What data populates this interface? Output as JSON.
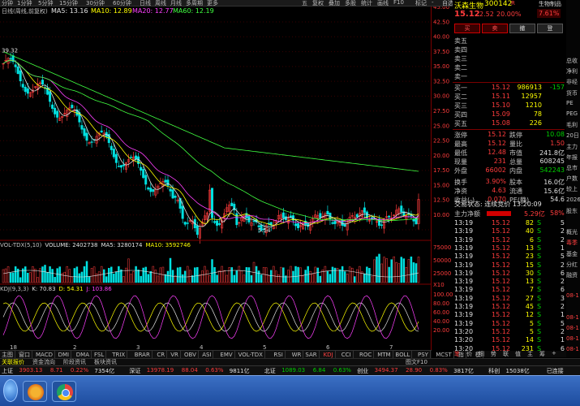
{
  "toolbar": {
    "cycles": [
      "分钟",
      "1分钟",
      "5分钟",
      "15分钟",
      "30分钟",
      "60分钟",
      "日线",
      "周线",
      "月线",
      "多周期",
      "更多"
    ],
    "right_buttons": [
      "五",
      "复权",
      "叠加",
      "多股",
      "统计",
      "画线",
      "F10",
      "标记",
      "-",
      "自选",
      "返回"
    ]
  },
  "info": {
    "prefix": "日线(周线,前复权)",
    "ma5": "MA5: 13.16",
    "ma10": "MA10: 12.89",
    "ma20": "MA20: 12.77",
    "ma60": "MA60: 12.19",
    "high_mark": "39.32",
    "low_mark": "5.54"
  },
  "price_axis": [
    "45.00",
    "42.50",
    "40.00",
    "37.50",
    "35.00",
    "32.50",
    "30.00",
    "27.50",
    "25.00",
    "22.50",
    "20.00",
    "17.50",
    "15.00",
    "12.50",
    "10.00"
  ],
  "volume": {
    "title": "VOL-TDX(5,10)",
    "vol": "VOLUME: 2402738",
    "ma5": "MA5: 3280174",
    "ma10": "MA10: 3592746",
    "axis": [
      "75000",
      "50000",
      "25000",
      "X10"
    ]
  },
  "kdj": {
    "title": "KDJ(9,3,3)",
    "k": "K: 70.83",
    "d": "D: 54.31",
    "j": "J: 103.86",
    "axis": [
      "100.00",
      "80.00",
      "60.00",
      "40.00",
      "20.00"
    ]
  },
  "timeline_labels": [
    "18",
    "2",
    "3",
    "4",
    "5",
    "6",
    "7"
  ],
  "tabs": [
    "主图",
    "窗口",
    "MACD",
    "DMI",
    "DMA",
    "FSL",
    "TRIX",
    "BRAR",
    "CR",
    "VR",
    "OBV",
    "ASI",
    "EMV",
    "VOL-TDX",
    "RSI",
    "WR",
    "SAR",
    "KDJ",
    "CCI",
    "ROC",
    "MTM",
    "BOLL",
    "PSY",
    "MCST",
    "指标",
    "模板"
  ],
  "selected_tab": "KDJ",
  "tabs2": [
    "关联报价",
    "资金流向",
    "阶段资讯",
    "板块资讯"
  ],
  "tabs2_right": "图文F10",
  "stock": {
    "name": "沃森生物",
    "code": "300142",
    "badge": "R",
    "price": "15.12",
    "change": "2.52",
    "pct": "20.00%",
    "side_label": "生物制品",
    "side_pct": "7.61%"
  },
  "trade_buttons": [
    "买",
    "卖",
    "撤",
    "登"
  ],
  "asks": [
    {
      "label": "卖五",
      "price": "",
      "vol": ""
    },
    {
      "label": "卖四",
      "price": "",
      "vol": ""
    },
    {
      "label": "卖三",
      "price": "",
      "vol": ""
    },
    {
      "label": "卖二",
      "price": "",
      "vol": ""
    },
    {
      "label": "卖一",
      "price": "",
      "vol": ""
    }
  ],
  "bids": [
    {
      "label": "买一",
      "price": "15.12",
      "vol": "986913",
      "chg": "-157"
    },
    {
      "label": "买二",
      "price": "15.11",
      "vol": "12957",
      "chg": ""
    },
    {
      "label": "买三",
      "price": "15.10",
      "vol": "1210",
      "chg": ""
    },
    {
      "label": "买四",
      "price": "15.09",
      "vol": "78",
      "chg": ""
    },
    {
      "label": "买五",
      "price": "15.08",
      "vol": "226",
      "chg": ""
    }
  ],
  "stats": [
    {
      "l1": "涨停",
      "v1": "15.12",
      "l2": "跌停",
      "v2": "10.08"
    },
    {
      "l1": "最高",
      "v1": "15.12",
      "l2": "量比",
      "v2": "1.50"
    },
    {
      "l1": "最低",
      "v1": "12.48",
      "l2": "市值",
      "v2": "241.8亿"
    },
    {
      "l1": "现量",
      "v1": "231",
      "l2": "总量",
      "v2": "608245"
    },
    {
      "l1": "外盘",
      "v1": "66002",
      "l2": "内盘",
      "v2": "542243"
    },
    {
      "l1": "换手",
      "v1": "3.90%",
      "l2": "股本",
      "v2": "16.0亿"
    },
    {
      "l1": "净资",
      "v1": "4.63",
      "l2": "流通",
      "v2": "15.6亿"
    },
    {
      "l1": "收益(-)",
      "v1": "0.070",
      "l2": "PE(静)",
      "v2": "54.6"
    }
  ],
  "trade_status": "交易状态: 连续竞价 13:20:09",
  "main_inflow": {
    "label": "主力净额",
    "value": "5.29亿",
    "pct": "58%"
  },
  "ticks": [
    {
      "t": "13:19",
      "p": "15.12",
      "v": "82",
      "d": "S",
      "n": "5"
    },
    {
      "t": "13:19",
      "p": "15.12",
      "v": "40",
      "d": "S",
      "n": "2"
    },
    {
      "t": "13:19",
      "p": "15.12",
      "v": "6",
      "d": "S",
      "n": "2"
    },
    {
      "t": "13:19",
      "p": "15.12",
      "v": "13",
      "d": "S",
      "n": "1"
    },
    {
      "t": "13:19",
      "p": "15.12",
      "v": "23",
      "d": "S",
      "n": "5"
    },
    {
      "t": "13:19",
      "p": "15.12",
      "v": "15",
      "d": "S",
      "n": "2"
    },
    {
      "t": "13:19",
      "p": "15.12",
      "v": "30",
      "d": "S",
      "n": "6"
    },
    {
      "t": "13:19",
      "p": "15.12",
      "v": "13",
      "d": "S",
      "n": "2"
    },
    {
      "t": "13:19",
      "p": "15.12",
      "v": "7",
      "d": "S",
      "n": "6"
    },
    {
      "t": "13:19",
      "p": "15.12",
      "v": "27",
      "d": "S",
      "n": "3"
    },
    {
      "t": "13:19",
      "p": "15.12",
      "v": "45",
      "d": "S",
      "n": "2"
    },
    {
      "t": "13:19",
      "p": "15.12",
      "v": "12",
      "d": "S",
      "n": "1"
    },
    {
      "t": "13:19",
      "p": "15.12",
      "v": "5",
      "d": "S",
      "n": "5"
    },
    {
      "t": "13:20",
      "p": "15.12",
      "v": "5",
      "d": "S",
      "n": "2"
    },
    {
      "t": "13:20",
      "p": "15.12",
      "v": "14",
      "d": "S",
      "n": "1"
    },
    {
      "t": "13:20",
      "p": "15.12",
      "v": "231",
      "d": "S",
      "n": "6"
    }
  ],
  "bottom_tabs": [
    "笔",
    "价",
    "细",
    "势",
    "联",
    "值",
    "主",
    "筹",
    "+"
  ],
  "narrow": [
    "总收",
    "净利",
    "非经",
    "货币",
    "PE",
    "PEG",
    "毛利",
    "20日",
    "主力",
    "年报",
    "总市",
    "户数",
    "较上",
    "2026",
    "股东",
    "",
    "概光",
    "毒季",
    "基金",
    "分红",
    "融资",
    "",
    "08-1",
    "",
    "08-1",
    "08-1",
    "08-1",
    "08-1"
  ],
  "status": [
    {
      "t": "上证",
      "c": "wht"
    },
    {
      "t": "3903.13",
      "c": "red"
    },
    {
      "t": "8.71",
      "c": "red"
    },
    {
      "t": "0.22%",
      "c": "red"
    },
    {
      "t": "7354亿",
      "c": "wht"
    },
    {
      "t": "深证",
      "c": "wht"
    },
    {
      "t": "13978.19",
      "c": "red"
    },
    {
      "t": "88.04",
      "c": "red"
    },
    {
      "t": "0.63%",
      "c": "red"
    },
    {
      "t": "9811亿",
      "c": "wht"
    },
    {
      "t": "北证",
      "c": "wht"
    },
    {
      "t": "1089.03",
      "c": "green"
    },
    {
      "t": "6.84",
      "c": "green"
    },
    {
      "t": "0.63%",
      "c": "green"
    },
    {
      "t": "创业",
      "c": "wht"
    },
    {
      "t": "3494.37",
      "c": "red"
    },
    {
      "t": "28.90",
      "c": "red"
    },
    {
      "t": "0.83%",
      "c": "red"
    },
    {
      "t": "3817亿",
      "c": "wht"
    },
    {
      "t": "科创",
      "c": "wht"
    },
    {
      "t": "15038亿",
      "c": "wht"
    },
    {
      "t": "已连接",
      "c": "wht"
    }
  ]
}
